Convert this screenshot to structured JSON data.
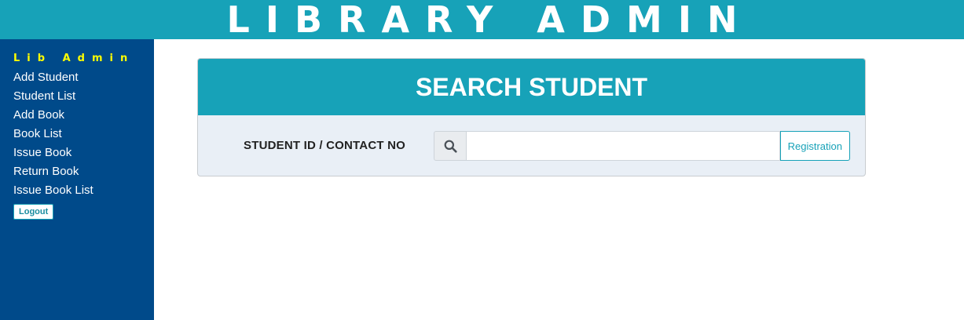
{
  "header": {
    "title": "LIBRARY ADMIN"
  },
  "sidebar": {
    "brand": "Lib Admin",
    "items": [
      {
        "label": "Add Student"
      },
      {
        "label": "Student List"
      },
      {
        "label": "Add Book"
      },
      {
        "label": "Book List"
      },
      {
        "label": "Issue Book"
      },
      {
        "label": "Return Book"
      },
      {
        "label": "Issue Book List"
      }
    ],
    "logout_label": "Logout"
  },
  "search_card": {
    "title": "SEARCH STUDENT",
    "field_label": "STUDENT ID / CONTACT NO",
    "input_value": "",
    "input_placeholder": "",
    "search_icon": "search-icon",
    "button_label": "Registration"
  },
  "colors": {
    "header_bg": "#17a2b8",
    "sidebar_bg": "#004a8a",
    "brand_text": "#ffff00",
    "card_body_bg": "#e9eff6"
  }
}
